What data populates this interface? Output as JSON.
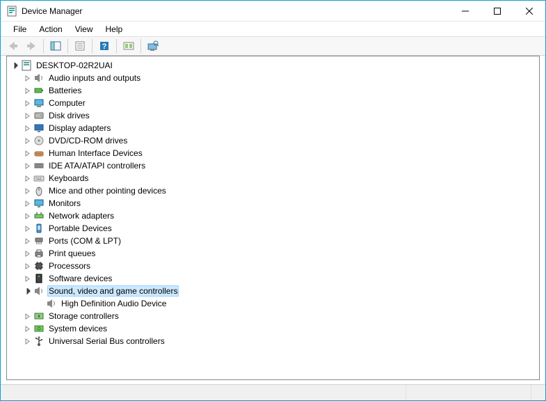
{
  "window": {
    "title": "Device Manager"
  },
  "menubar": {
    "items": [
      "File",
      "Action",
      "View",
      "Help"
    ]
  },
  "tree": {
    "root": "DESKTOP-02R2UAI",
    "categories": [
      {
        "label": "Audio inputs and outputs",
        "icon": "speaker",
        "expanded": false
      },
      {
        "label": "Batteries",
        "icon": "battery",
        "expanded": false
      },
      {
        "label": "Computer",
        "icon": "computer",
        "expanded": false
      },
      {
        "label": "Disk drives",
        "icon": "disk",
        "expanded": false
      },
      {
        "label": "Display adapters",
        "icon": "display",
        "expanded": false
      },
      {
        "label": "DVD/CD-ROM drives",
        "icon": "dvd",
        "expanded": false
      },
      {
        "label": "Human Interface Devices",
        "icon": "hid",
        "expanded": false
      },
      {
        "label": "IDE ATA/ATAPI controllers",
        "icon": "ide",
        "expanded": false
      },
      {
        "label": "Keyboards",
        "icon": "keyboard",
        "expanded": false
      },
      {
        "label": "Mice and other pointing devices",
        "icon": "mouse",
        "expanded": false
      },
      {
        "label": "Monitors",
        "icon": "monitor",
        "expanded": false
      },
      {
        "label": "Network adapters",
        "icon": "network",
        "expanded": false
      },
      {
        "label": "Portable Devices",
        "icon": "portable",
        "expanded": false
      },
      {
        "label": "Ports (COM & LPT)",
        "icon": "port",
        "expanded": false
      },
      {
        "label": "Print queues",
        "icon": "printer",
        "expanded": false
      },
      {
        "label": "Processors",
        "icon": "cpu",
        "expanded": false
      },
      {
        "label": "Software devices",
        "icon": "software",
        "expanded": false
      },
      {
        "label": "Sound, video and game controllers",
        "icon": "speaker",
        "expanded": true,
        "selected": true,
        "children": [
          {
            "label": "High Definition Audio Device",
            "icon": "speaker"
          }
        ]
      },
      {
        "label": "Storage controllers",
        "icon": "storage",
        "expanded": false
      },
      {
        "label": "System devices",
        "icon": "system",
        "expanded": false
      },
      {
        "label": "Universal Serial Bus controllers",
        "icon": "usb",
        "expanded": false
      }
    ]
  }
}
